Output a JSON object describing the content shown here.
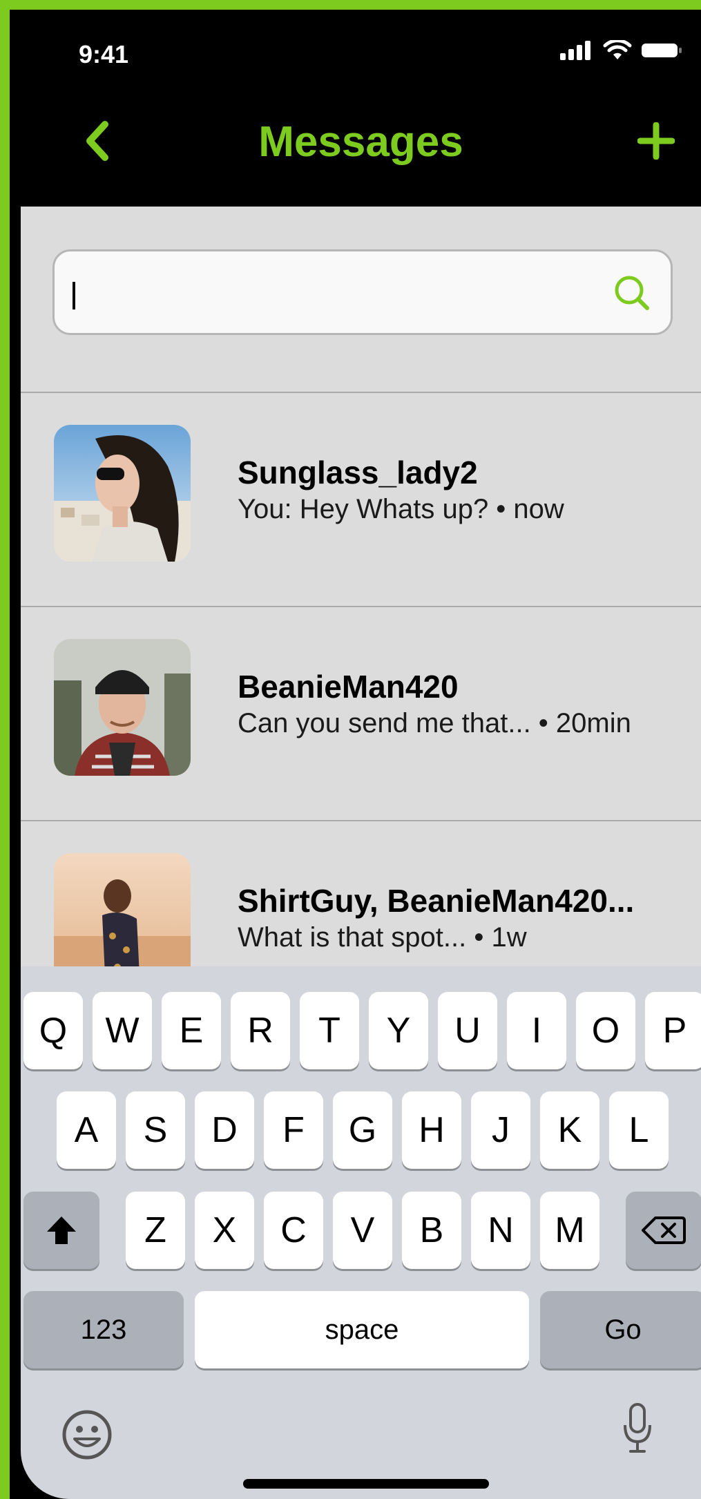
{
  "status": {
    "time": "9:41"
  },
  "nav": {
    "title": "Messages"
  },
  "search": {
    "value": "",
    "placeholder": ""
  },
  "conversations": [
    {
      "name": "Sunglass_lady2",
      "preview": "You: Hey Whats up? • now"
    },
    {
      "name": "BeanieMan420",
      "preview": "Can you send me that... • 20min"
    },
    {
      "name": "ShirtGuy, BeanieMan420...",
      "preview": "What is that spot... • 1w"
    }
  ],
  "keyboard": {
    "row1": [
      "Q",
      "W",
      "E",
      "R",
      "T",
      "Y",
      "U",
      "I",
      "O",
      "P"
    ],
    "row2": [
      "A",
      "S",
      "D",
      "F",
      "G",
      "H",
      "J",
      "K",
      "L"
    ],
    "row3": [
      "Z",
      "X",
      "C",
      "V",
      "B",
      "N",
      "M"
    ],
    "numbers_label": "123",
    "space_label": "space",
    "go_label": "Go"
  },
  "colors": {
    "accent": "#7dcb1f",
    "background": "#dcdcdc",
    "keyboard": "#d2d5db"
  }
}
